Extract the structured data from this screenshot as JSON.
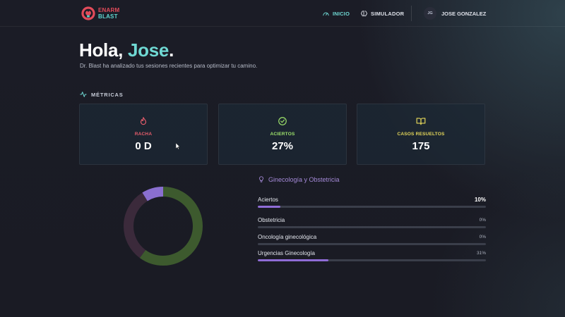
{
  "header": {
    "logo": {
      "line1": "ENARM",
      "line2": "BLAST"
    },
    "nav": [
      {
        "label": "INICIO",
        "icon": "gauge-icon",
        "active": true
      },
      {
        "label": "SIMULADOR",
        "icon": "brain-icon",
        "active": false
      }
    ],
    "user": {
      "initials": "JG",
      "name": "JOSE GONZALEZ"
    }
  },
  "greeting": {
    "hello": "Hola,",
    "name": "Jose",
    "punct": "."
  },
  "subtitle": "Dr. Blast ha analizado tus sesiones recientes para optimizar tu camino.",
  "metrics": {
    "label": "MÉTRICAS",
    "cards": [
      {
        "label": "RACHA",
        "value": "0 D",
        "icon": "flame-icon",
        "color": "#e85d6c"
      },
      {
        "label": "ACIERTOS",
        "value": "27%",
        "icon": "check-circle-icon",
        "color": "#9ee36b"
      },
      {
        "label": "CASOS RESUELTOS",
        "value": "175",
        "icon": "book-open-icon",
        "color": "#e6d85a"
      }
    ]
  },
  "donut": {
    "segments": [
      {
        "fraction": 0.6,
        "color": "#3d5a2e"
      },
      {
        "fraction": 0.31,
        "color": "#3b2a3b"
      },
      {
        "fraction": 0.09,
        "color": "#8a6fd0"
      }
    ]
  },
  "topic": {
    "title": "Ginecología y Obstetricia",
    "rows": [
      {
        "label": "Aciertos",
        "value": "10%",
        "progress": 0.1
      },
      {
        "label": "Obstetricia",
        "value": "0%",
        "progress": 0
      },
      {
        "label": "Oncología ginecológica",
        "value": "0%",
        "progress": 0
      },
      {
        "label": "Urgencias Ginecología",
        "value": "31%",
        "progress": 0.31
      }
    ]
  }
}
